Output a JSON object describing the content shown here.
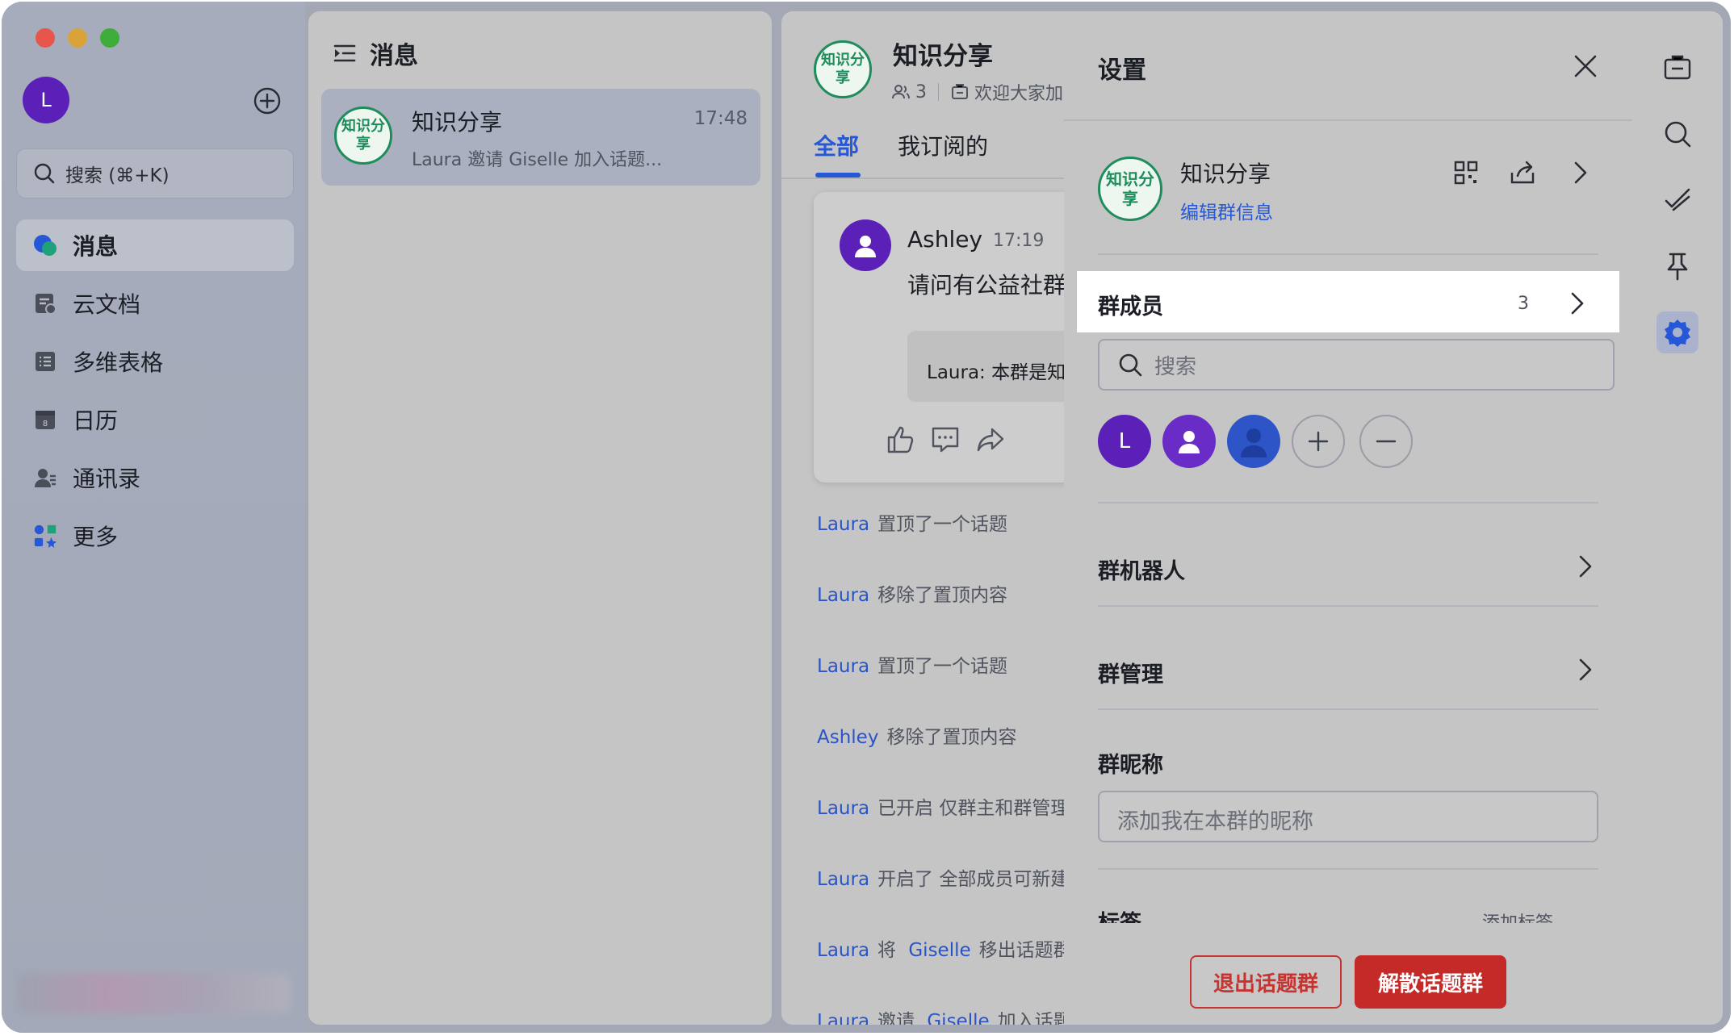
{
  "sidebar": {
    "user_initial": "L",
    "search_placeholder": "搜索 (⌘+K)",
    "items": [
      {
        "label": "消息",
        "icon": "chat-bubbles-icon",
        "active": true
      },
      {
        "label": "云文档",
        "icon": "cloud-doc-icon"
      },
      {
        "label": "多维表格",
        "icon": "table-icon"
      },
      {
        "label": "日历",
        "icon": "calendar-icon"
      },
      {
        "label": "通讯录",
        "icon": "contacts-icon"
      },
      {
        "label": "更多",
        "icon": "more-apps-icon"
      }
    ]
  },
  "messages_panel": {
    "title": "消息",
    "chats": [
      {
        "avatar_text": "知识分享",
        "name": "知识分享",
        "time": "17:48",
        "preview": "Laura 邀请 Giselle 加入话题..."
      }
    ]
  },
  "chat": {
    "avatar_text": "知识分享",
    "name": "知识分享",
    "member_count": "3",
    "description": "欢迎大家加",
    "tabs": [
      "全部",
      "我订阅的"
    ],
    "active_tab": 0,
    "post": {
      "author": "Ashley",
      "time": "17:19",
      "text": "请问有公益社群",
      "quote": "Laura: 本群是知"
    },
    "system_events": [
      {
        "user": "Laura",
        "text": "置顶了一个话题"
      },
      {
        "user": "Laura",
        "text": "移除了置顶内容"
      },
      {
        "user": "Laura",
        "text": "置顶了一个话题"
      },
      {
        "user": "Ashley",
        "text": "移除了置顶内容"
      },
      {
        "user": "Laura",
        "text": "已开启 仅群主和群管理"
      },
      {
        "user": "Laura",
        "text": "开启了 全部成员可新建"
      },
      {
        "user": "Laura",
        "text": "将",
        "target": "Giselle",
        "text2": "移出话题群"
      },
      {
        "user": "Laura",
        "text": "邀请",
        "target": "Giselle",
        "text2": "加入话题"
      }
    ]
  },
  "settings": {
    "title": "设置",
    "group_avatar_text": "知识分享",
    "group_name": "知识分享",
    "edit_info": "编辑群信息",
    "members_label": "群成员",
    "members_count": "3",
    "search_placeholder": "搜索",
    "member_initial": "L",
    "bots_label": "群机器人",
    "manage_label": "群管理",
    "nickname_label": "群昵称",
    "nickname_placeholder": "添加我在本群的昵称",
    "tags_label": "标签",
    "tags_add": "添加标签",
    "exit_button": "退出话题群",
    "dissolve_button": "解散话题群"
  },
  "colors": {
    "accent": "#2557d6",
    "danger": "#c42a28",
    "group_green": "#1f8c5b",
    "avatar_purple": "#5b20b8"
  }
}
